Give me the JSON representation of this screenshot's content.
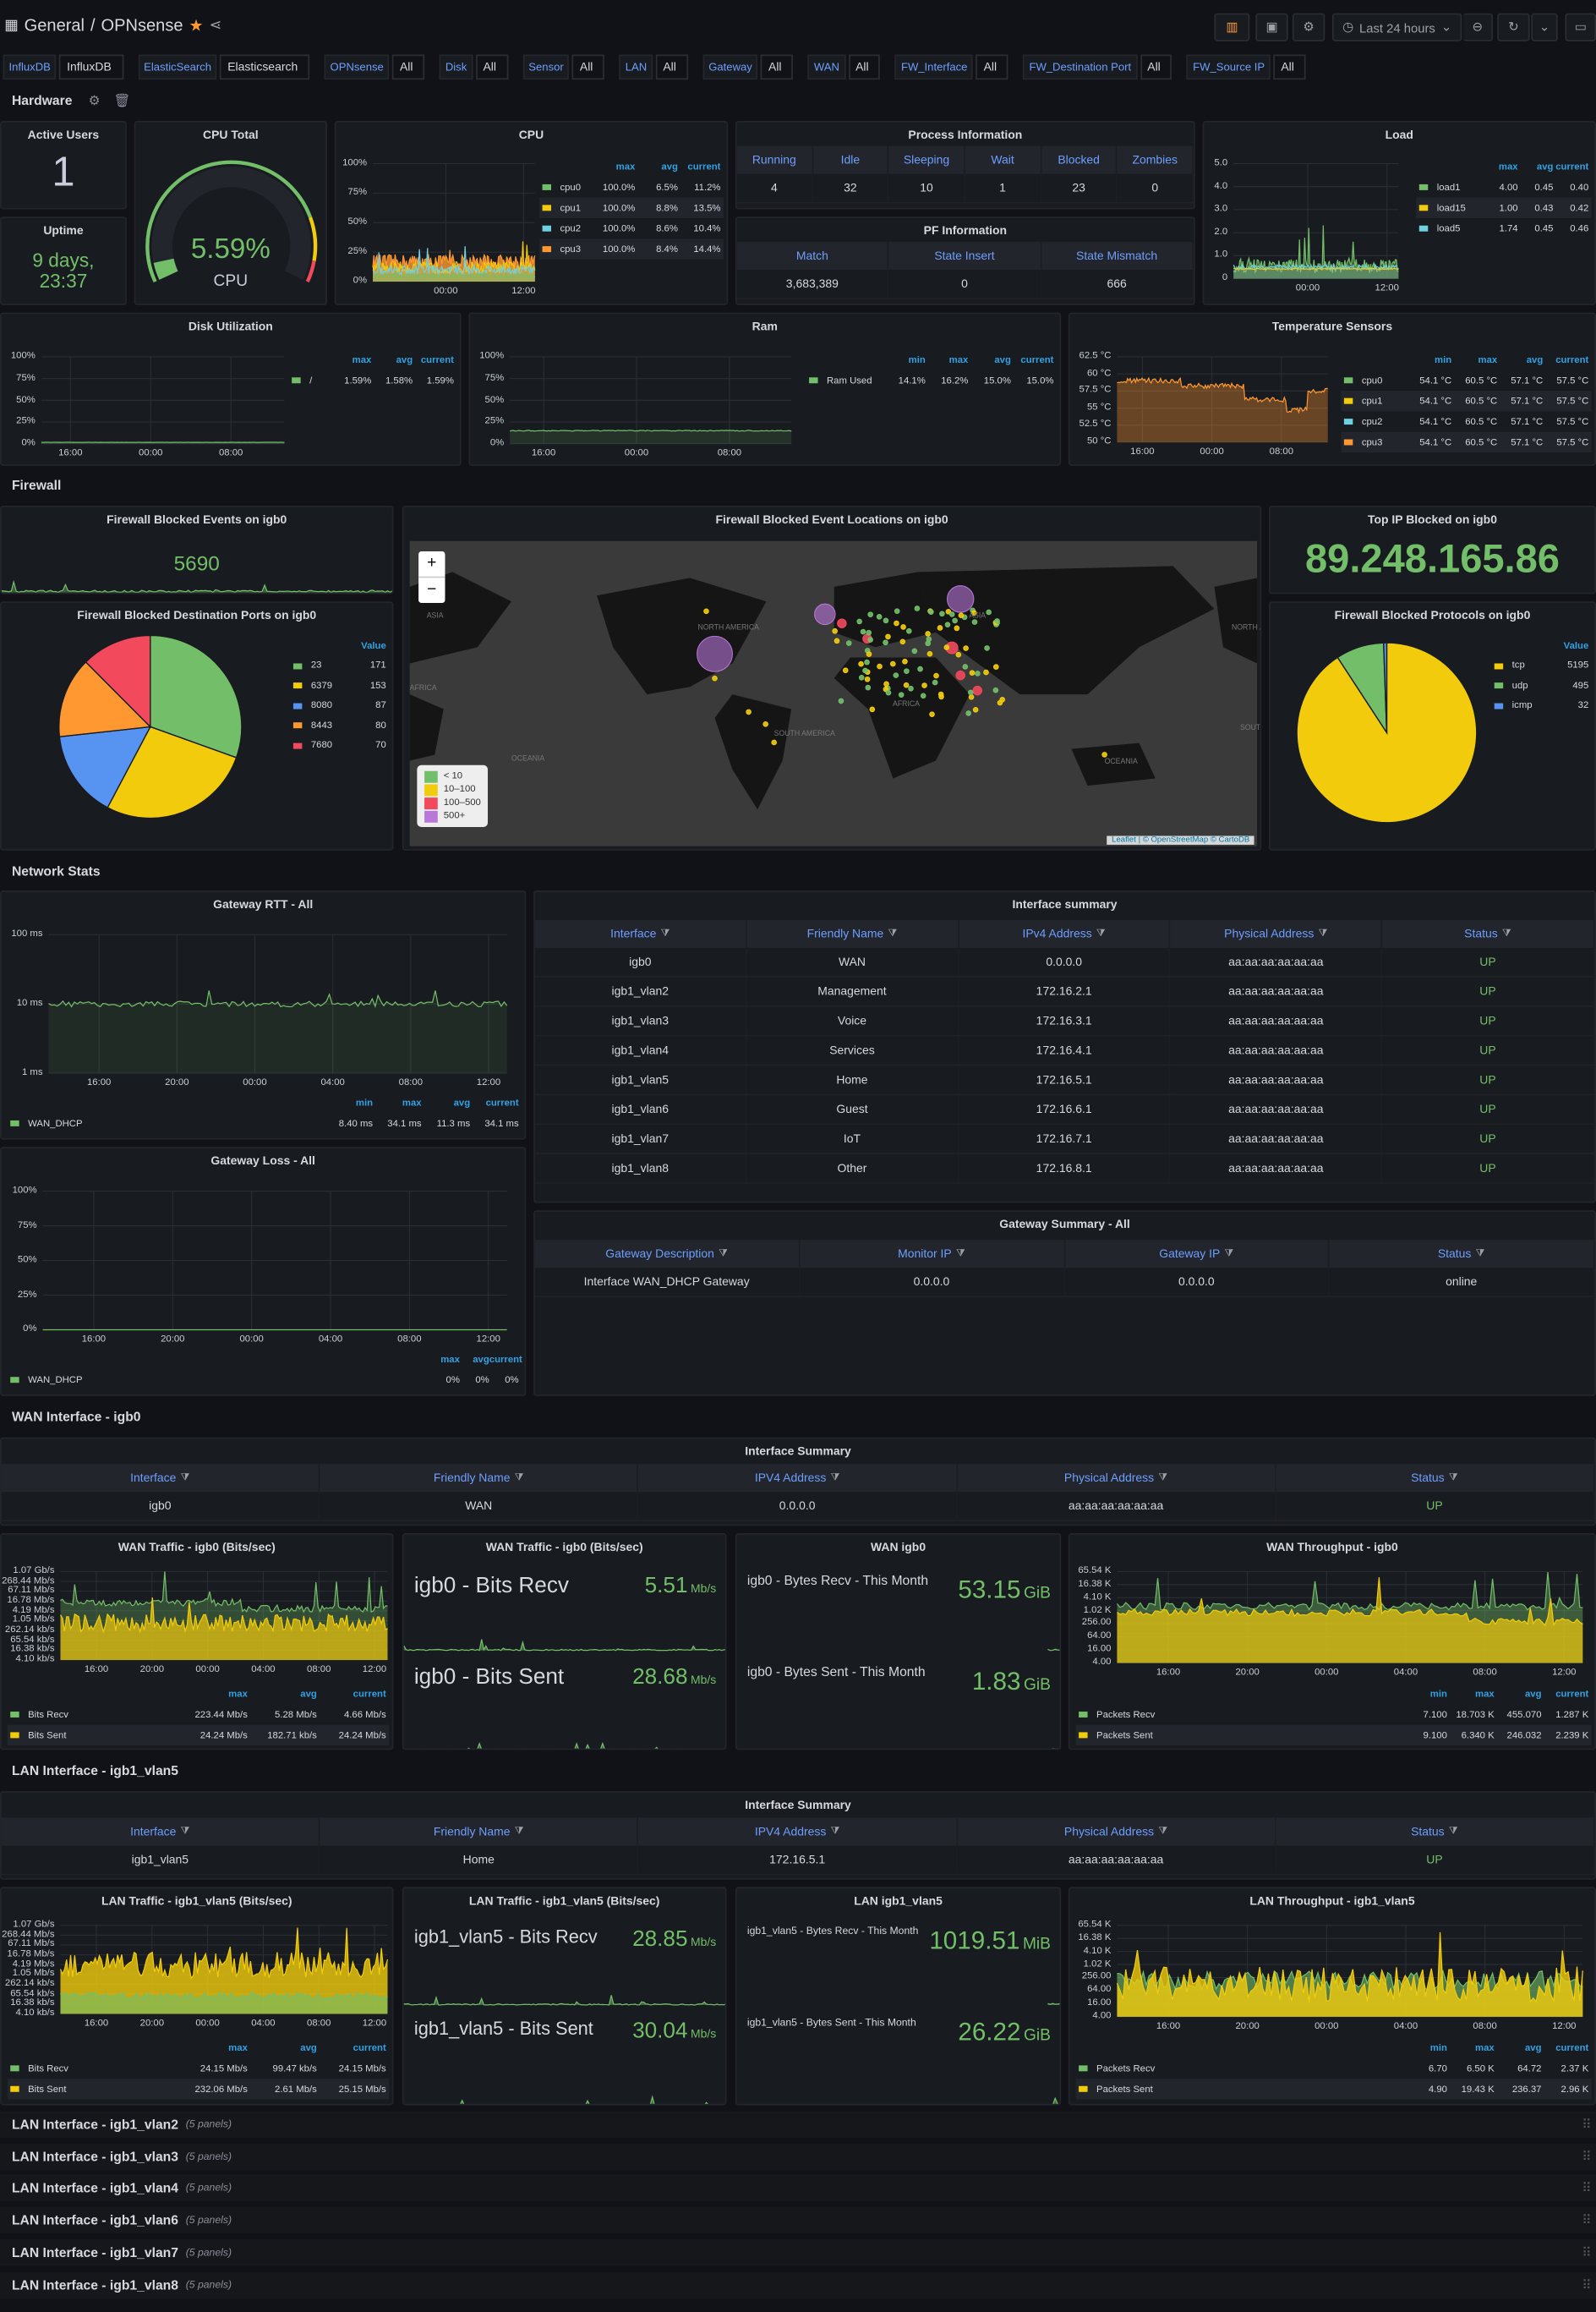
{
  "header": {
    "folder": "General",
    "separator": "/",
    "title": "OPNsense",
    "time_range": "Last 24 hours"
  },
  "variables": [
    {
      "label": "InfluxDB",
      "value": "InfluxDB"
    },
    {
      "label": "ElasticSearch",
      "value": "Elasticsearch"
    },
    {
      "label": "OPNsense",
      "value": "All"
    },
    {
      "label": "Disk",
      "value": "All"
    },
    {
      "label": "Sensor",
      "value": "All"
    },
    {
      "label": "LAN",
      "value": "All"
    },
    {
      "label": "Gateway",
      "value": "All"
    },
    {
      "label": "WAN",
      "value": "All"
    },
    {
      "label": "FW_Interface",
      "value": "All"
    },
    {
      "label": "FW_Destination Port",
      "value": "All"
    },
    {
      "label": "FW_Source IP",
      "value": "All"
    }
  ],
  "rows": {
    "hardware": "Hardware",
    "firewall": "Firewall",
    "network": "Network Stats",
    "wan": "WAN Interface - igb0",
    "lan": "LAN Interface - igb1_vlan5"
  },
  "collapsed_rows": [
    {
      "title": "LAN Interface - igb1_vlan2",
      "count": "(5 panels)"
    },
    {
      "title": "LAN Interface - igb1_vlan3",
      "count": "(5 panels)"
    },
    {
      "title": "LAN Interface - igb1_vlan4",
      "count": "(5 panels)"
    },
    {
      "title": "LAN Interface - igb1_vlan6",
      "count": "(5 panels)"
    },
    {
      "title": "LAN Interface - igb1_vlan7",
      "count": "(5 panels)"
    },
    {
      "title": "LAN Interface - igb1_vlan8",
      "count": "(5 panels)"
    }
  ],
  "colors": {
    "green": "#73bf69",
    "yellow": "#f2cc0c",
    "blue": "#5794f2",
    "cyan": "#6ed0e0",
    "orange": "#ff9830",
    "red": "#f2495c",
    "purple": "#b877d9",
    "text_blue": "#6e9fff"
  },
  "panels": {
    "active_users": {
      "title": "Active Users",
      "value": "1"
    },
    "uptime": {
      "title": "Uptime",
      "value": "9 days, 23:37"
    },
    "cpu_total": {
      "title": "CPU Total",
      "value": "5.59%",
      "label": "CPU",
      "percent": 5.59
    },
    "cpu": {
      "title": "CPU",
      "y_ticks": [
        "100%",
        "75%",
        "50%",
        "25%",
        "0%"
      ],
      "x_ticks": [
        "00:00",
        "12:00"
      ],
      "legend": {
        "columns": [
          "max",
          "avg",
          "current"
        ],
        "series": [
          {
            "name": "cpu0",
            "color": "#73bf69",
            "values": [
              "100.0%",
              "6.5%",
              "11.2%"
            ]
          },
          {
            "name": "cpu1",
            "color": "#f2cc0c",
            "values": [
              "100.0%",
              "8.8%",
              "13.5%"
            ]
          },
          {
            "name": "cpu2",
            "color": "#6ed0e0",
            "values": [
              "100.0%",
              "8.6%",
              "10.4%"
            ]
          },
          {
            "name": "cpu3",
            "color": "#ff9830",
            "values": [
              "100.0%",
              "8.4%",
              "14.4%"
            ]
          }
        ]
      }
    },
    "process": {
      "title": "Process Information",
      "columns": [
        "Running",
        "Idle",
        "Sleeping",
        "Wait",
        "Blocked",
        "Zombies"
      ],
      "rows": [
        [
          "4",
          "32",
          "10",
          "1",
          "23",
          "0"
        ]
      ]
    },
    "pf": {
      "title": "PF Information",
      "columns": [
        "Match",
        "State Insert",
        "State Mismatch"
      ],
      "rows": [
        [
          "3,683,389",
          "0",
          "666"
        ]
      ]
    },
    "load": {
      "title": "Load",
      "y_ticks": [
        "5.0",
        "4.0",
        "3.0",
        "2.0",
        "1.0",
        "0"
      ],
      "x_ticks": [
        "00:00",
        "12:00"
      ],
      "legend": {
        "columns": [
          "max",
          "avg",
          "current"
        ],
        "series": [
          {
            "name": "load1",
            "color": "#73bf69",
            "values": [
              "4.00",
              "0.45",
              "0.40"
            ]
          },
          {
            "name": "load15",
            "color": "#f2cc0c",
            "values": [
              "1.00",
              "0.43",
              "0.42"
            ]
          },
          {
            "name": "load5",
            "color": "#6ed0e0",
            "values": [
              "1.74",
              "0.45",
              "0.46"
            ]
          }
        ]
      }
    },
    "disk": {
      "title": "Disk Utilization",
      "y_ticks": [
        "100%",
        "75%",
        "50%",
        "25%",
        "0%"
      ],
      "x_ticks": [
        "16:00",
        "00:00",
        "08:00"
      ],
      "legend": {
        "columns": [
          "max",
          "avg",
          "current"
        ],
        "series": [
          {
            "name": "/",
            "color": "#73bf69",
            "values": [
              "1.59%",
              "1.58%",
              "1.59%"
            ]
          }
        ]
      }
    },
    "ram": {
      "title": "Ram",
      "y_ticks": [
        "100%",
        "75%",
        "50%",
        "25%",
        "0%"
      ],
      "x_ticks": [
        "16:00",
        "00:00",
        "08:00"
      ],
      "legend": {
        "columns": [
          "min",
          "max",
          "avg",
          "current"
        ],
        "series": [
          {
            "name": "Ram Used",
            "color": "#73bf69",
            "values": [
              "14.1%",
              "16.2%",
              "15.0%",
              "15.0%"
            ]
          }
        ]
      }
    },
    "temp": {
      "title": "Temperature Sensors",
      "y_ticks": [
        "62.5 °C",
        "60 °C",
        "57.5 °C",
        "55 °C",
        "52.5 °C",
        "50 °C"
      ],
      "x_ticks": [
        "16:00",
        "00:00",
        "08:00"
      ],
      "legend": {
        "columns": [
          "min",
          "max",
          "avg",
          "current"
        ],
        "series": [
          {
            "name": "cpu0",
            "color": "#73bf69",
            "values": [
              "54.1 °C",
              "60.5 °C",
              "57.1 °C",
              "57.5 °C"
            ]
          },
          {
            "name": "cpu1",
            "color": "#f2cc0c",
            "values": [
              "54.1 °C",
              "60.5 °C",
              "57.1 °C",
              "57.5 °C"
            ]
          },
          {
            "name": "cpu2",
            "color": "#6ed0e0",
            "values": [
              "54.1 °C",
              "60.5 °C",
              "57.1 °C",
              "57.5 °C"
            ]
          },
          {
            "name": "cpu3",
            "color": "#ff9830",
            "values": [
              "54.1 °C",
              "60.5 °C",
              "57.1 °C",
              "57.5 °C"
            ]
          }
        ]
      }
    },
    "fw_events": {
      "title": "Firewall Blocked Events on igb0",
      "value": "5690"
    },
    "fw_map": {
      "title": "Firewall Blocked Event Locations on igb0",
      "zoom_in": "+",
      "zoom_out": "−",
      "attribution": "Leaflet | © OpenStreetMap © CartoDB",
      "labels": [
        "NORTH AMERICA",
        "SOUTH AMERICA",
        "AFRICA",
        "ASIA",
        "OCEANIA",
        "ASIA",
        "AFRICA",
        "OCEANIA",
        "NORTH AMERICA",
        "SOUTH AMERICA"
      ],
      "legend": [
        {
          "label": "< 10",
          "color": "#73bf69"
        },
        {
          "label": "10–100",
          "color": "#f2cc0c"
        },
        {
          "label": "100–500",
          "color": "#f2495c"
        },
        {
          "label": "500+",
          "color": "#b877d9"
        }
      ]
    },
    "fw_top_ip": {
      "title": "Top IP Blocked on igb0",
      "value": "89.248.165.86"
    },
    "fw_ports": {
      "title": "Firewall Blocked Destination Ports on igb0",
      "legend_header": "Value",
      "slices": [
        {
          "name": "23",
          "value": 171,
          "color": "#73bf69"
        },
        {
          "name": "6379",
          "value": 153,
          "color": "#f2cc0c"
        },
        {
          "name": "8080",
          "value": 87,
          "color": "#5794f2"
        },
        {
          "name": "8443",
          "value": 80,
          "color": "#ff9830"
        },
        {
          "name": "7680",
          "value": 70,
          "color": "#f2495c"
        }
      ]
    },
    "fw_protocols": {
      "title": "Firewall Blocked Protocols on igb0",
      "legend_header": "Value",
      "slices": [
        {
          "name": "tcp",
          "value": 5195,
          "color": "#f2cc0c"
        },
        {
          "name": "udp",
          "value": 495,
          "color": "#73bf69"
        },
        {
          "name": "icmp",
          "value": 32,
          "color": "#5794f2"
        }
      ]
    },
    "gw_rtt": {
      "title": "Gateway RTT - All",
      "y_ticks": [
        "100 ms",
        "10 ms",
        "1 ms"
      ],
      "x_ticks": [
        "16:00",
        "20:00",
        "00:00",
        "04:00",
        "08:00",
        "12:00"
      ],
      "legend": {
        "columns": [
          "min",
          "max",
          "avg",
          "current"
        ],
        "series": [
          {
            "name": "WAN_DHCP",
            "color": "#73bf69",
            "values": [
              "8.40 ms",
              "34.1 ms",
              "11.3 ms",
              "34.1 ms"
            ]
          }
        ]
      }
    },
    "gw_loss": {
      "title": "Gateway Loss - All",
      "y_ticks": [
        "100%",
        "75%",
        "50%",
        "25%",
        "0%"
      ],
      "x_ticks": [
        "16:00",
        "20:00",
        "00:00",
        "04:00",
        "08:00",
        "12:00"
      ],
      "legend": {
        "columns": [
          "max",
          "avg",
          "current"
        ],
        "series": [
          {
            "name": "WAN_DHCP",
            "color": "#73bf69",
            "values": [
              "0%",
              "0%",
              "0%"
            ]
          }
        ]
      }
    },
    "if_summary": {
      "title": "Interface summary",
      "columns": [
        "Interface",
        "Friendly Name",
        "IPv4 Address",
        "Physical Address",
        "Status"
      ],
      "rows": [
        [
          "igb0",
          "WAN",
          "0.0.0.0",
          "aa:aa:aa:aa:aa:aa",
          "UP"
        ],
        [
          "igb1_vlan2",
          "Management",
          "172.16.2.1",
          "aa:aa:aa:aa:aa:aa",
          "UP"
        ],
        [
          "igb1_vlan3",
          "Voice",
          "172.16.3.1",
          "aa:aa:aa:aa:aa:aa",
          "UP"
        ],
        [
          "igb1_vlan4",
          "Services",
          "172.16.4.1",
          "aa:aa:aa:aa:aa:aa",
          "UP"
        ],
        [
          "igb1_vlan5",
          "Home",
          "172.16.5.1",
          "aa:aa:aa:aa:aa:aa",
          "UP"
        ],
        [
          "igb1_vlan6",
          "Guest",
          "172.16.6.1",
          "aa:aa:aa:aa:aa:aa",
          "UP"
        ],
        [
          "igb1_vlan7",
          "IoT",
          "172.16.7.1",
          "aa:aa:aa:aa:aa:aa",
          "UP"
        ],
        [
          "igb1_vlan8",
          "Other",
          "172.16.8.1",
          "aa:aa:aa:aa:aa:aa",
          "UP"
        ]
      ]
    },
    "gw_summary": {
      "title": "Gateway Summary - All",
      "columns": [
        "Gateway Description",
        "Monitor IP",
        "Gateway IP",
        "Status"
      ],
      "rows": [
        [
          "Interface WAN_DHCP Gateway",
          "0.0.0.0",
          "0.0.0.0",
          "online"
        ]
      ]
    },
    "wan_table": {
      "title": "Interface Summary",
      "columns": [
        "Interface",
        "Friendly Name",
        "IPV4 Address",
        "Physical Address",
        "Status"
      ],
      "rows": [
        [
          "igb0",
          "WAN",
          "0.0.0.0",
          "aa:aa:aa:aa:aa:aa",
          "UP"
        ]
      ]
    },
    "wan_traffic": {
      "title": "WAN Traffic - igb0 (Bits/sec)",
      "y_ticks": [
        "1.07 Gb/s",
        "268.44 Mb/s",
        "67.11 Mb/s",
        "16.78 Mb/s",
        "4.19 Mb/s",
        "1.05 Mb/s",
        "262.14 kb/s",
        "65.54 kb/s",
        "16.38 kb/s",
        "4.10 kb/s"
      ],
      "x_ticks": [
        "16:00",
        "20:00",
        "00:00",
        "04:00",
        "08:00",
        "12:00"
      ],
      "legend": {
        "columns": [
          "max",
          "avg",
          "current"
        ],
        "series": [
          {
            "name": "Bits Recv",
            "color": "#73bf69",
            "values": [
              "223.44 Mb/s",
              "5.28 Mb/s",
              "4.66 Mb/s"
            ]
          },
          {
            "name": "Bits Sent",
            "color": "#f2cc0c",
            "values": [
              "24.24 Mb/s",
              "182.71 kb/s",
              "24.24 Mb/s"
            ]
          }
        ]
      }
    },
    "wan_stat": {
      "title": "WAN Traffic - igb0 (Bits/sec)",
      "items": [
        {
          "label": "igb0 - Bits Recv",
          "value": "5.51",
          "unit": "Mb/s"
        },
        {
          "label": "igb0 - Bits Sent",
          "value": "28.68",
          "unit": "Mb/s"
        }
      ]
    },
    "wan_month": {
      "title": "WAN igb0",
      "items": [
        {
          "label": "igb0 - Bytes Recv - This Month",
          "value": "53.15",
          "unit": "GiB"
        },
        {
          "label": "igb0 - Bytes Sent - This Month",
          "value": "1.83",
          "unit": "GiB"
        }
      ]
    },
    "wan_thr": {
      "title": "WAN Throughput - igb0",
      "y_ticks": [
        "65.54 K",
        "16.38 K",
        "4.10 K",
        "1.02 K",
        "256.00",
        "64.00",
        "16.00",
        "4.00"
      ],
      "x_ticks": [
        "16:00",
        "20:00",
        "00:00",
        "04:00",
        "08:00",
        "12:00"
      ],
      "legend": {
        "columns": [
          "min",
          "max",
          "avg",
          "current"
        ],
        "series": [
          {
            "name": "Packets Recv",
            "color": "#73bf69",
            "values": [
              "7.100",
              "18.703 K",
              "455.070",
              "1.287 K"
            ]
          },
          {
            "name": "Packets Sent",
            "color": "#f2cc0c",
            "values": [
              "9.100",
              "6.340 K",
              "246.032",
              "2.239 K"
            ]
          }
        ]
      }
    },
    "lan_table": {
      "title": "Interface Summary",
      "columns": [
        "Interface",
        "Friendly Name",
        "IPV4 Address",
        "Physical Address",
        "Status"
      ],
      "rows": [
        [
          "igb1_vlan5",
          "Home",
          "172.16.5.1",
          "aa:aa:aa:aa:aa:aa",
          "UP"
        ]
      ]
    },
    "lan_traffic": {
      "title": "LAN Traffic - igb1_vlan5 (Bits/sec)",
      "y_ticks": [
        "1.07 Gb/s",
        "268.44 Mb/s",
        "67.11 Mb/s",
        "16.78 Mb/s",
        "4.19 Mb/s",
        "1.05 Mb/s",
        "262.14 kb/s",
        "65.54 kb/s",
        "16.38 kb/s",
        "4.10 kb/s"
      ],
      "x_ticks": [
        "16:00",
        "20:00",
        "00:00",
        "04:00",
        "08:00",
        "12:00"
      ],
      "legend": {
        "columns": [
          "max",
          "avg",
          "current"
        ],
        "series": [
          {
            "name": "Bits Recv",
            "color": "#73bf69",
            "values": [
              "24.15 Mb/s",
              "99.47 kb/s",
              "24.15 Mb/s"
            ]
          },
          {
            "name": "Bits Sent",
            "color": "#f2cc0c",
            "values": [
              "232.06 Mb/s",
              "2.61 Mb/s",
              "25.15 Mb/s"
            ]
          }
        ]
      }
    },
    "lan_stat": {
      "title": "LAN Traffic - igb1_vlan5 (Bits/sec)",
      "items": [
        {
          "label": "igb1_vlan5 - Bits Recv",
          "value": "28.85",
          "unit": "Mb/s"
        },
        {
          "label": "igb1_vlan5 - Bits Sent",
          "value": "30.04",
          "unit": "Mb/s"
        }
      ]
    },
    "lan_month": {
      "title": "LAN igb1_vlan5",
      "items": [
        {
          "label": "igb1_vlan5 - Bytes Recv - This Month",
          "value": "1019.51",
          "unit": "MiB"
        },
        {
          "label": "igb1_vlan5 - Bytes Sent - This Month",
          "value": "26.22",
          "unit": "GiB"
        }
      ]
    },
    "lan_thr": {
      "title": "LAN Throughput - igb1_vlan5",
      "y_ticks": [
        "65.54 K",
        "16.38 K",
        "4.10 K",
        "1.02 K",
        "256.00",
        "64.00",
        "16.00",
        "4.00"
      ],
      "x_ticks": [
        "16:00",
        "20:00",
        "00:00",
        "04:00",
        "08:00",
        "12:00"
      ],
      "legend": {
        "columns": [
          "min",
          "max",
          "avg",
          "current"
        ],
        "series": [
          {
            "name": "Packets Recv",
            "color": "#73bf69",
            "values": [
              "6.70",
              "6.50 K",
              "64.72",
              "2.37 K"
            ]
          },
          {
            "name": "Packets Sent",
            "color": "#f2cc0c",
            "values": [
              "4.90",
              "19.43 K",
              "236.37",
              "2.96 K"
            ]
          }
        ]
      }
    }
  }
}
